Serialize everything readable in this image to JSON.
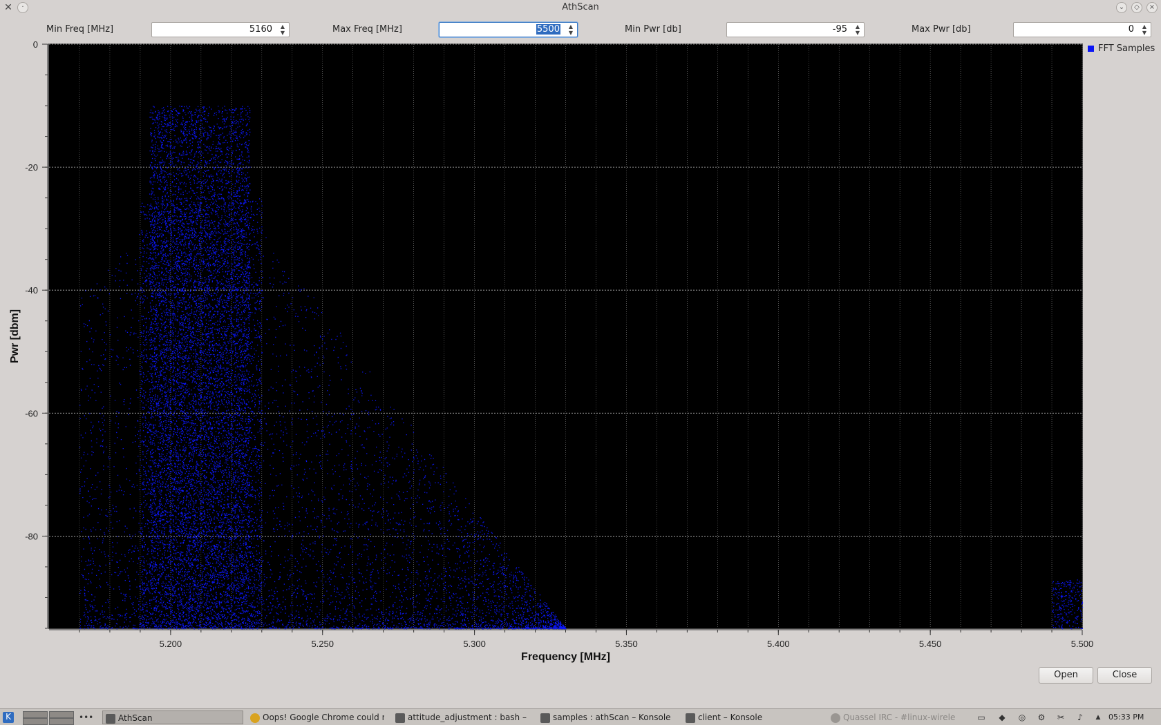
{
  "window": {
    "title": "AthScan"
  },
  "controls": {
    "min_freq": {
      "label": "Min Freq [MHz]",
      "value": "5160"
    },
    "max_freq": {
      "label": "Max Freq [MHz]",
      "value": "5500"
    },
    "min_pwr": {
      "label": "Min Pwr [db]",
      "value": "-95"
    },
    "max_pwr": {
      "label": "Max Pwr [db]",
      "value": "0"
    }
  },
  "buttons": {
    "open": "Open",
    "close": "Close"
  },
  "colors": {
    "samples": "#0b16f5",
    "plot_bg": "#000000",
    "grid": "#bdbdbd"
  },
  "chart_data": {
    "type": "scatter",
    "xlabel": "Frequency [MHz]",
    "ylabel": "Pwr [dbm]",
    "xlim": [
      5.16,
      5.5
    ],
    "ylim": [
      -95,
      0
    ],
    "x_ticks": [
      "5.200",
      "5.250",
      "5.300",
      "5.350",
      "5.400",
      "5.450",
      "5.500"
    ],
    "x_tick_values": [
      5.2,
      5.25,
      5.3,
      5.35,
      5.4,
      5.45,
      5.5
    ],
    "y_ticks": [
      "0",
      "-20",
      "-40",
      "-60",
      "-80"
    ],
    "y_tick_values": [
      0,
      -20,
      -40,
      -60,
      -80
    ],
    "grid": true,
    "legend_position": "right",
    "series": [
      {
        "name": "FFT Samples",
        "dense_regions": [
          {
            "x_range": [
              5.193,
              5.226
            ],
            "y_range": [
              -95,
              -10
            ]
          },
          {
            "x_range": [
              5.19,
              5.23
            ],
            "y_range": [
              -95,
              -25
            ]
          },
          {
            "x_range": [
              5.17,
              5.33
            ],
            "y_range": [
              -95,
              -30
            ]
          },
          {
            "x_range": [
              5.49,
              5.5
            ],
            "y_range": [
              -95,
              -87
            ]
          }
        ]
      }
    ]
  },
  "taskbar": {
    "items": [
      {
        "label": "AthScan",
        "icon": "athscan-icon"
      },
      {
        "label": "Oops! Google Chrome could no",
        "icon": "chrome-icon"
      },
      {
        "label": "attitude_adjustment : bash – K",
        "icon": "konsole-icon"
      },
      {
        "label": "samples : athScan – Konsole",
        "icon": "konsole-icon"
      },
      {
        "label": "client – Konsole",
        "icon": "konsole-icon"
      },
      {
        "label": "Quassel IRC - #linux-wireless",
        "icon": "quassel-icon"
      }
    ],
    "clock": "05:33 PM"
  }
}
